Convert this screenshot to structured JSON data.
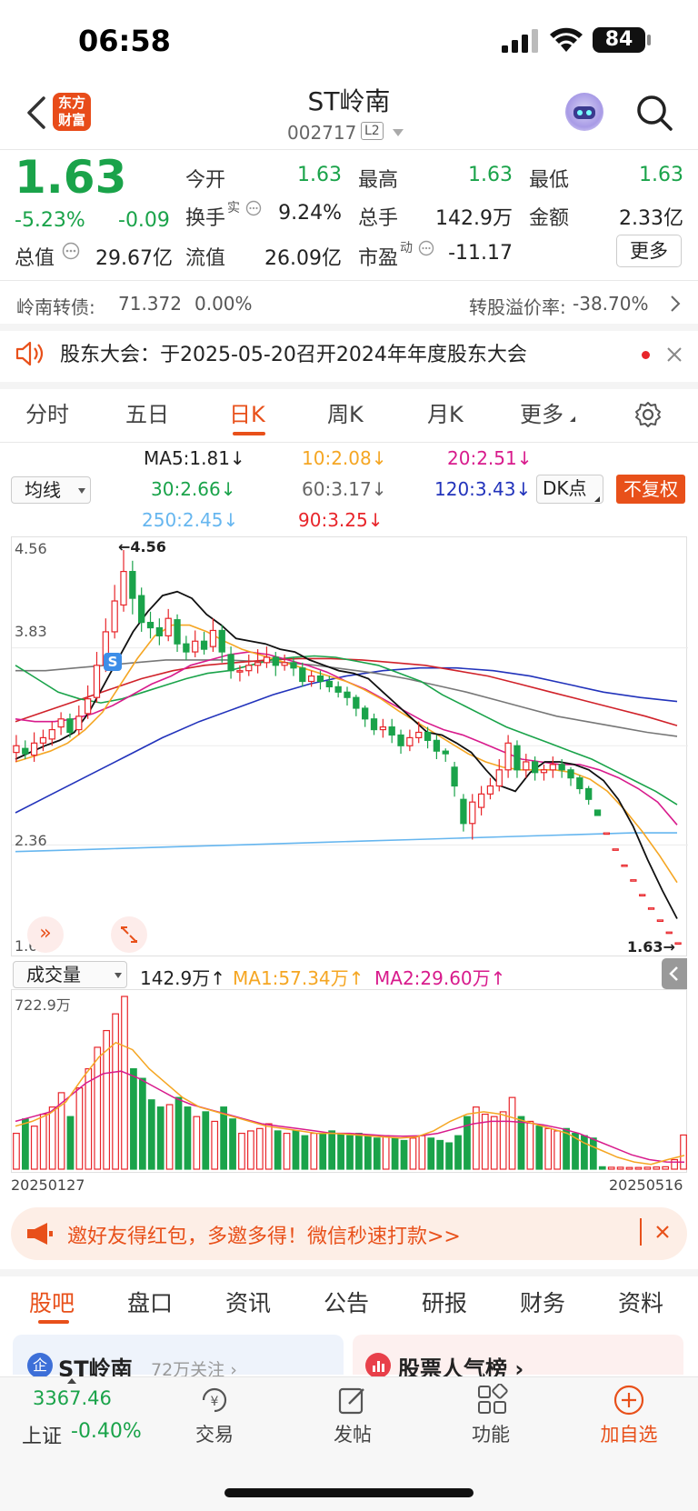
{
  "status": {
    "time": "06:58",
    "battery": "84"
  },
  "header": {
    "logo_line1": "东方",
    "logo_line2": "财富",
    "stock_name": "ST岭南",
    "stock_code": "002717",
    "level_badge": "L2"
  },
  "quote": {
    "price": "1.63",
    "change_pct": "-5.23%",
    "change_amt": "-0.09",
    "total_value_label": "总值",
    "total_value": "29.67亿",
    "more_label": "更多",
    "stats": [
      {
        "label": "今开",
        "value": "1.63"
      },
      {
        "label": "最高",
        "value": "1.63"
      },
      {
        "label": "最低",
        "value": "1.63"
      },
      {
        "label": "换手",
        "tag": "实",
        "value": "9.24%"
      },
      {
        "label": "总手",
        "value": "142.9万"
      },
      {
        "label": "金额",
        "value": "2.33亿"
      },
      {
        "label": "流值",
        "value": "26.09亿"
      },
      {
        "label": "市盈",
        "tag": "动",
        "value": "-11.17"
      }
    ]
  },
  "bond": {
    "name": "岭南转债:",
    "price": "71.372",
    "change": "0.00%",
    "premium_label": "转股溢价率:",
    "premium_value": "-38.70%"
  },
  "notice": {
    "text": "股东大会：于2025-05-20召开2024年年度股东大会"
  },
  "chart_tabs": [
    "分时",
    "五日",
    "日K",
    "周K",
    "月K",
    "更多"
  ],
  "ma_legend": [
    "MA5:1.81↓",
    "10:2.08↓",
    "20:2.51↓",
    "30:2.66↓",
    "60:3.17↓",
    "120:3.43↓",
    "250:2.45↓",
    "90:3.25↓"
  ],
  "indicator_select": "均线",
  "dk_label": "DK点",
  "adjust_label": "不复权",
  "colors": {
    "up": "#e8252a",
    "down": "#1aa34a",
    "ma5": "#111111",
    "ma10": "#f5a623",
    "ma20": "#d81b8c",
    "ma30": "#1aa34a",
    "ma60": "#777777",
    "ma90": "#d0222a",
    "ma120": "#2233bb",
    "ma250": "#66b6ef",
    "accent": "#e8501a"
  },
  "volume": {
    "select_label": "成交量",
    "current": "142.9万↑",
    "ma1": "MA1:57.34万↑",
    "ma2": "MA2:29.60万↑",
    "max_label": "722.9万"
  },
  "chart_data": {
    "type": "candlestick",
    "axis_labels": [
      "4.56",
      "3.83",
      "2.36",
      "1.63"
    ],
    "ylim": [
      1.63,
      4.56
    ],
    "max_marker": "←4.56",
    "last_marker": "1.63→",
    "signal_badge": "S",
    "expand_glyph": "»",
    "start_date": "20250127",
    "end_date": "20250516",
    "candles": [
      [
        3.05,
        3.1,
        3.18,
        2.98
      ],
      [
        3.08,
        3.04,
        3.14,
        3.0
      ],
      [
        3.03,
        3.12,
        3.2,
        2.98
      ],
      [
        3.12,
        3.16,
        3.22,
        3.06
      ],
      [
        3.15,
        3.22,
        3.28,
        3.1
      ],
      [
        3.24,
        3.3,
        3.35,
        3.18
      ],
      [
        3.3,
        3.2,
        3.34,
        3.16
      ],
      [
        3.22,
        3.32,
        3.4,
        3.18
      ],
      [
        3.34,
        3.45,
        3.55,
        3.3
      ],
      [
        3.46,
        3.7,
        3.8,
        3.42
      ],
      [
        3.7,
        3.95,
        4.05,
        3.65
      ],
      [
        3.95,
        4.18,
        4.3,
        3.9
      ],
      [
        4.15,
        4.4,
        4.56,
        4.1
      ],
      [
        4.4,
        4.2,
        4.48,
        4.08
      ],
      [
        4.22,
        4.02,
        4.28,
        3.95
      ],
      [
        4.02,
        3.98,
        4.1,
        3.9
      ],
      [
        3.98,
        3.92,
        4.05,
        3.85
      ],
      [
        3.92,
        4.05,
        4.12,
        3.88
      ],
      [
        4.04,
        3.86,
        4.08,
        3.8
      ],
      [
        3.86,
        3.8,
        3.92,
        3.74
      ],
      [
        3.8,
        3.88,
        3.96,
        3.76
      ],
      [
        3.88,
        3.82,
        3.95,
        3.78
      ],
      [
        3.84,
        3.96,
        4.05,
        3.8
      ],
      [
        3.96,
        3.8,
        4.0,
        3.72
      ],
      [
        3.78,
        3.66,
        3.84,
        3.6
      ],
      [
        3.66,
        3.66,
        3.7,
        3.58
      ],
      [
        3.66,
        3.7,
        3.78,
        3.62
      ],
      [
        3.7,
        3.72,
        3.82,
        3.64
      ],
      [
        3.72,
        3.76,
        3.84,
        3.68
      ],
      [
        3.76,
        3.7,
        3.8,
        3.62
      ],
      [
        3.7,
        3.72,
        3.78,
        3.66
      ],
      [
        3.72,
        3.68,
        3.76,
        3.62
      ],
      [
        3.68,
        3.58,
        3.72,
        3.54
      ],
      [
        3.58,
        3.62,
        3.66,
        3.54
      ],
      [
        3.62,
        3.58,
        3.66,
        3.52
      ],
      [
        3.58,
        3.54,
        3.62,
        3.5
      ],
      [
        3.54,
        3.5,
        3.58,
        3.46
      ],
      [
        3.5,
        3.46,
        3.54,
        3.4
      ],
      [
        3.46,
        3.38,
        3.48,
        3.32
      ],
      [
        3.38,
        3.3,
        3.4,
        3.24
      ],
      [
        3.3,
        3.22,
        3.34,
        3.18
      ],
      [
        3.22,
        3.24,
        3.3,
        3.16
      ],
      [
        3.24,
        3.18,
        3.3,
        3.12
      ],
      [
        3.18,
        3.1,
        3.22,
        3.04
      ],
      [
        3.1,
        3.16,
        3.22,
        3.06
      ],
      [
        3.16,
        3.2,
        3.28,
        3.12
      ],
      [
        3.2,
        3.14,
        3.24,
        3.08
      ],
      [
        3.14,
        3.06,
        3.18,
        3.0
      ],
      [
        3.06,
        3.04,
        3.08,
        2.98
      ],
      [
        2.94,
        2.8,
        2.98,
        2.72
      ],
      [
        2.7,
        2.52,
        2.74,
        2.46
      ],
      [
        2.52,
        2.68,
        2.74,
        2.4
      ],
      [
        2.64,
        2.74,
        2.8,
        2.58
      ],
      [
        2.74,
        2.8,
        2.86,
        2.7
      ],
      [
        2.8,
        2.92,
        3.0,
        2.76
      ],
      [
        2.92,
        3.12,
        3.18,
        2.86
      ],
      [
        3.1,
        2.92,
        3.14,
        2.86
      ],
      [
        2.92,
        2.98,
        3.04,
        2.86
      ],
      [
        2.98,
        2.9,
        3.02,
        2.84
      ],
      [
        2.9,
        2.92,
        2.96,
        2.84
      ],
      [
        2.92,
        2.96,
        3.02,
        2.86
      ],
      [
        2.96,
        2.92,
        3.0,
        2.86
      ],
      [
        2.92,
        2.86,
        2.94,
        2.8
      ],
      [
        2.86,
        2.78,
        2.88,
        2.74
      ],
      [
        2.78,
        2.7,
        2.8,
        2.66
      ],
      [
        2.62,
        2.58,
        2.62,
        2.58
      ],
      [
        2.45,
        2.45,
        2.45,
        2.45
      ],
      [
        2.33,
        2.33,
        2.33,
        2.33
      ],
      [
        2.21,
        2.21,
        2.21,
        2.21
      ],
      [
        2.1,
        2.1,
        2.1,
        2.1
      ],
      [
        1.99,
        1.99,
        1.99,
        1.99
      ],
      [
        1.89,
        1.89,
        1.89,
        1.89
      ],
      [
        1.8,
        1.8,
        1.8,
        1.8
      ],
      [
        1.71,
        1.71,
        1.71,
        1.71
      ],
      [
        1.63,
        1.63,
        1.63,
        1.63
      ]
    ],
    "volume_values": [
      150,
      210,
      180,
      230,
      260,
      320,
      220,
      340,
      420,
      510,
      580,
      650,
      722.9,
      420,
      380,
      290,
      260,
      270,
      300,
      260,
      220,
      240,
      200,
      260,
      210,
      150,
      160,
      170,
      190,
      160,
      150,
      160,
      140,
      150,
      150,
      160,
      150,
      140,
      150,
      140,
      130,
      140,
      130,
      120,
      130,
      140,
      130,
      120,
      110,
      140,
      220,
      260,
      230,
      220,
      240,
      300,
      220,
      200,
      180,
      170,
      160,
      170,
      150,
      140,
      130,
      10,
      8,
      8,
      7,
      7,
      8,
      9,
      10,
      40,
      142.9
    ],
    "ma_series": {
      "ma5": [
        3.0,
        3.05,
        3.1,
        3.14,
        3.2,
        3.35,
        3.55,
        3.75,
        3.95,
        4.1,
        4.22,
        4.25,
        4.2,
        4.08,
        4.0,
        3.9,
        3.88,
        3.86,
        3.82,
        3.8,
        3.74,
        3.7,
        3.66,
        3.64,
        3.6,
        3.5,
        3.4,
        3.3,
        3.2,
        3.18,
        3.12,
        3.05,
        2.92,
        2.8,
        2.76,
        2.9,
        2.98,
        2.98,
        2.96,
        2.92,
        2.84,
        2.7,
        2.5,
        2.25,
        2.02,
        1.81
      ],
      "ma10": [
        2.98,
        3.02,
        3.06,
        3.12,
        3.22,
        3.35,
        3.55,
        3.75,
        3.92,
        4.0,
        4.0,
        3.95,
        3.88,
        3.82,
        3.78,
        3.74,
        3.7,
        3.66,
        3.62,
        3.58,
        3.52,
        3.45,
        3.36,
        3.28,
        3.2,
        3.12,
        3.04,
        2.98,
        2.94,
        2.92,
        2.92,
        2.92,
        2.9,
        2.85,
        2.76,
        2.62,
        2.46,
        2.28,
        2.08
      ],
      "ma20": [
        3.3,
        3.28,
        3.28,
        3.3,
        3.34,
        3.4,
        3.48,
        3.56,
        3.62,
        3.7,
        3.74,
        3.78,
        3.8,
        3.78,
        3.74,
        3.7,
        3.65,
        3.58,
        3.52,
        3.44,
        3.36,
        3.28,
        3.22,
        3.18,
        3.12,
        3.06,
        3.0,
        2.98,
        2.96,
        2.96,
        2.92,
        2.86,
        2.78,
        2.68,
        2.51
      ],
      "ma30": [
        3.7,
        3.6,
        3.5,
        3.45,
        3.42,
        3.45,
        3.5,
        3.55,
        3.6,
        3.64,
        3.66,
        3.7,
        3.74,
        3.76,
        3.77,
        3.76,
        3.73,
        3.7,
        3.64,
        3.58,
        3.48,
        3.4,
        3.32,
        3.24,
        3.18,
        3.12,
        3.06,
        3.0,
        2.92,
        2.84,
        2.76,
        2.66
      ],
      "ma60": [
        3.66,
        3.66,
        3.68,
        3.7,
        3.72,
        3.74,
        3.74,
        3.74,
        3.73,
        3.72,
        3.7,
        3.67,
        3.64,
        3.6,
        3.55,
        3.5,
        3.44,
        3.38,
        3.32,
        3.28,
        3.24,
        3.2,
        3.17
      ],
      "ma90": [
        3.28,
        3.36,
        3.44,
        3.52,
        3.6,
        3.66,
        3.7,
        3.72,
        3.74,
        3.75,
        3.75,
        3.74,
        3.72,
        3.7,
        3.66,
        3.62,
        3.56,
        3.5,
        3.44,
        3.38,
        3.32,
        3.25
      ],
      "ma120": [
        2.6,
        2.74,
        2.88,
        3.02,
        3.16,
        3.28,
        3.38,
        3.48,
        3.56,
        3.62,
        3.66,
        3.68,
        3.68,
        3.66,
        3.62,
        3.56,
        3.5,
        3.46,
        3.43
      ],
      "ma250": [
        2.31,
        2.32,
        2.33,
        2.34,
        2.35,
        2.36,
        2.37,
        2.38,
        2.39,
        2.4,
        2.41,
        2.42,
        2.43,
        2.44,
        2.45,
        2.45
      ]
    },
    "volume_ma": {
      "ma1": [
        180,
        200,
        230,
        280,
        380,
        470,
        530,
        500,
        420,
        360,
        300,
        260,
        240,
        220,
        200,
        180,
        170,
        160,
        150,
        150,
        145,
        140,
        135,
        130,
        135,
        160,
        200,
        230,
        240,
        230,
        210,
        190,
        170,
        150,
        110,
        80,
        50,
        30,
        20,
        40,
        57.34
      ],
      "ma2": [
        200,
        220,
        240,
        300,
        360,
        400,
        410,
        380,
        340,
        300,
        270,
        250,
        230,
        210,
        190,
        180,
        170,
        160,
        150,
        150,
        145,
        140,
        138,
        140,
        150,
        170,
        190,
        200,
        200,
        195,
        185,
        170,
        150,
        120,
        90,
        60,
        40,
        30,
        29.6
      ]
    }
  },
  "promo": {
    "text": "邀好友得红包，多邀多得！微信秒速打款>>"
  },
  "content_tabs": [
    "股吧",
    "盘口",
    "资讯",
    "公告",
    "研报",
    "财务",
    "资料"
  ],
  "cards": {
    "follow_icon": "企",
    "stock_name": "ST岭南",
    "followers": "72万关注 ›",
    "popularity_title": "股票人气榜 ›"
  },
  "bottom_nav": {
    "index_value": "3367.46",
    "index_name": "上证",
    "index_change": "-0.40%",
    "items": [
      "交易",
      "发帖",
      "功能",
      "加自选"
    ]
  }
}
